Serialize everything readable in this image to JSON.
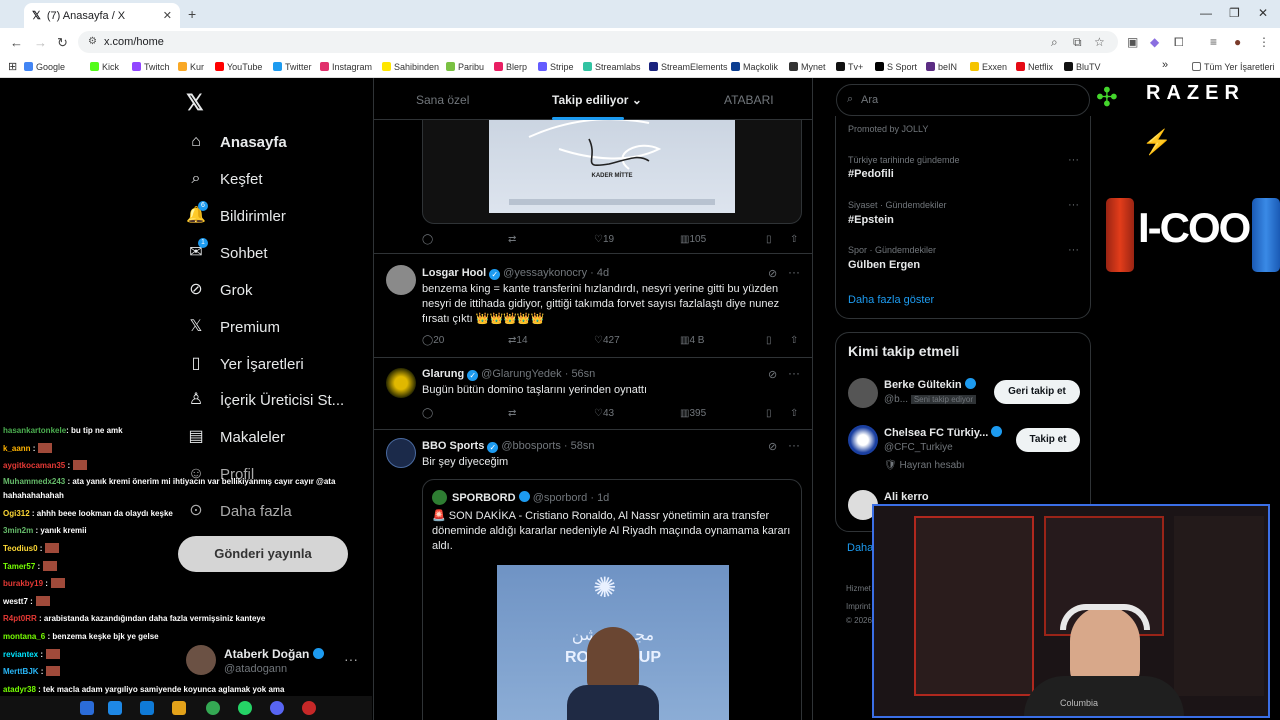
{
  "browser": {
    "tab_title": "(7) Anasayfa / X",
    "url": "x.com/home",
    "bookmarks": [
      {
        "label": "Google",
        "color": "#4285f4"
      },
      {
        "label": "Kick",
        "color": "#53fc18"
      },
      {
        "label": "Twitch",
        "color": "#9146ff"
      },
      {
        "label": "Kur",
        "color": "#f9a825"
      },
      {
        "label": "YouTube",
        "color": "#ff0000"
      },
      {
        "label": "Twitter",
        "color": "#1d9bf0"
      },
      {
        "label": "Instagram",
        "color": "#e1306c"
      },
      {
        "label": "Sahibinden",
        "color": "#ffe600"
      },
      {
        "label": "Paribu",
        "color": "#7ac142"
      },
      {
        "label": "Blerp",
        "color": "#e91e63"
      },
      {
        "label": "Stripe",
        "color": "#635bff"
      },
      {
        "label": "Streamlabs",
        "color": "#31c3a2"
      },
      {
        "label": "StreamElements",
        "color": "#1a237e"
      },
      {
        "label": "Maçkolik",
        "color": "#0b3d91"
      },
      {
        "label": "Mynet",
        "color": "#333333"
      },
      {
        "label": "Tv+",
        "color": "#111111"
      },
      {
        "label": "S Sport",
        "color": "#000000"
      },
      {
        "label": "beIN",
        "color": "#5b2c83"
      },
      {
        "label": "Exxen",
        "color": "#f5c400"
      },
      {
        "label": "Netflix",
        "color": "#e50914"
      },
      {
        "label": "BluTV",
        "color": "#111111"
      }
    ],
    "all_bookmarks": "Tüm Yer İşaretleri"
  },
  "sidebar": {
    "items": [
      {
        "label": "Anasayfa",
        "icon": "home-icon",
        "active": true
      },
      {
        "label": "Keşfet",
        "icon": "search-icon"
      },
      {
        "label": "Bildirimler",
        "icon": "bell-icon",
        "badge": "6"
      },
      {
        "label": "Sohbet",
        "icon": "mail-icon",
        "badge": "1"
      },
      {
        "label": "Grok",
        "icon": "grok-icon"
      },
      {
        "label": "Premium",
        "icon": "x-icon"
      },
      {
        "label": "Yer İşaretleri",
        "icon": "bookmark-icon"
      },
      {
        "label": "İçerik Üreticisi St...",
        "icon": "creator-icon"
      },
      {
        "label": "Makaleler",
        "icon": "article-icon"
      },
      {
        "label": "Profil",
        "icon": "profile-icon"
      },
      {
        "label": "Daha fazla",
        "icon": "more-icon"
      }
    ],
    "post_button": "Gönderi yayınla",
    "account": {
      "name": "Ataberk Doğan",
      "handle": "@atadogann"
    }
  },
  "chat": [
    {
      "user": "hasankartonkele",
      "color": "#4caf50",
      "text": ": bu tip ne amk"
    },
    {
      "user": "k_aann",
      "color": "#ffb300",
      "text": " :"
    },
    {
      "user": "aygitkocaman35",
      "color": "#e53935",
      "text": " :"
    },
    {
      "user": "Muhammedx243",
      "color": "#66bb6a",
      "text": " : ata yanık kremi önerim mi ihtiyacın var bellikiyanmış cayır cayır @ata hahahahahahah"
    },
    {
      "user": "Ogi312",
      "color": "#fdd835",
      "text": " : ahhh beee lookman da olaydı keşke"
    },
    {
      "user": "3min2m",
      "color": "#66bb6a",
      "text": " : yanık kremii"
    },
    {
      "user": "Teodius0",
      "color": "#fdd835",
      "text": " :"
    },
    {
      "user": "Tamer57",
      "color": "#76ff03",
      "text": " :"
    },
    {
      "user": "burakby19",
      "color": "#e53935",
      "text": " :"
    },
    {
      "user": "westt7",
      "color": "#ffffff",
      "text": " :"
    },
    {
      "user": "R4pt0RR",
      "color": "#e53935",
      "text": " : arabistanda kazandığından daha fazla vermişsiniz kanteye"
    },
    {
      "user": "montana_6",
      "color": "#76ff03",
      "text": " : benzema keşke bjk ye gelse"
    },
    {
      "user": "reviantex",
      "color": "#00e5ff",
      "text": " :"
    },
    {
      "user": "MerttBJK",
      "color": "#29b6f6",
      "text": " :"
    },
    {
      "user": "atadyr38",
      "color": "#76ff03",
      "text": " : tek macla adam yargıliyo samiyende koyunca aglamak yok ama"
    },
    {
      "user": "N8ananiz",
      "color": "#fdd835",
      "text": " :"
    }
  ],
  "main": {
    "tabs": [
      {
        "label": "Sana özel"
      },
      {
        "label": "Takip ediliyor",
        "active": true
      },
      {
        "label": "ATABARI"
      }
    ],
    "tweets": [
      {
        "media_caption": "KADER MİTTE",
        "replies": "",
        "retweets": "",
        "likes": "19",
        "views": "105"
      },
      {
        "name": "Losgar Hool",
        "handle": "@yessaykonocry",
        "time": "· 4d",
        "text": "benzema king = kante transferini hızlandırdı, nesyri yerine gitti bu yüzden nesyri de ittihada gidiyor, gittiği takımda forvet sayısı fazlalaştı diye nunez fırsatı çıktı 👑👑👑👑👑",
        "replies": "20",
        "retweets": "14",
        "likes": "427",
        "views": "4 B"
      },
      {
        "name": "Glarung",
        "handle": "@GlarungYedek",
        "time": "· 56sn",
        "text": "Bugün bütün domino taşlarını yerinden oynattı",
        "replies": "",
        "retweets": "",
        "likes": "43",
        "views": "395"
      },
      {
        "name": "BBO Sports",
        "handle": "@bbosports",
        "time": "· 58sn",
        "text": "Bir şey diyeceğim",
        "quote": {
          "name": "SPORBORD",
          "handle": "@sporbord",
          "time": "· 1d",
          "text": "🚨 SON DAKİKA - Cristiano Ronaldo, Al Nassr yönetimin ara transfer döneminde aldığı kararlar nedeniyle Al Riyadh maçında oynamama kararı aldı.",
          "image_text_ar": "مجمع روشن",
          "image_text": "ROSHN CUP"
        }
      }
    ]
  },
  "right": {
    "search_placeholder": "Ara",
    "promoted": "Promoted by JOLLY",
    "trends": [
      {
        "meta": "Türkiye tarihinde gündemde",
        "title": "#Pedofili"
      },
      {
        "meta": "Siyaset · Gündemdekiler",
        "title": "#Epstein"
      },
      {
        "meta": "Spor · Gündemdekiler",
        "title": "Gülben Ergen"
      }
    ],
    "show_more": "Daha fazla göster",
    "who_title": "Kimi takip etmeli",
    "who": [
      {
        "name": "Berke Gültekin",
        "handle": "@b...",
        "tag": "Seni takip ediyor",
        "button": "Geri takip et"
      },
      {
        "name": "Chelsea FC Türkiy...",
        "handle": "@CFC_Turkiye",
        "tag": "Hayran hesabı",
        "button": "Takip et"
      },
      {
        "name": "Ali kerro",
        "handle": "",
        "tag": "",
        "button": ""
      }
    ],
    "who_more": "Daha",
    "footer": [
      "Hizmet",
      "Imprint",
      "© 2026"
    ]
  },
  "overlay": {
    "brand": "RAZER",
    "sponsor": "I-COOL",
    "cam_brand": "Columbia"
  }
}
